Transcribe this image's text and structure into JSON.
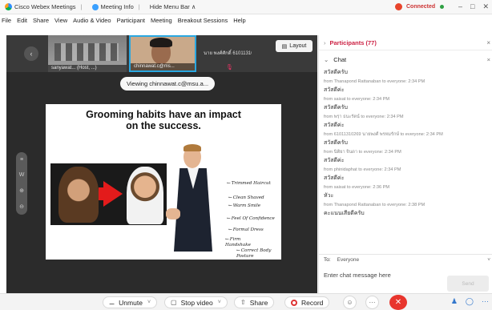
{
  "titlebar": {
    "app_name": "Cisco Webex Meetings",
    "meeting_info": "Meeting Info",
    "hide_menu_bar": "Hide Menu Bar ∧",
    "status": "Connected",
    "minimize": "–",
    "maximize": "□",
    "close": "✕"
  },
  "menu": [
    "File",
    "Edit",
    "Share",
    "View",
    "Audio & Video",
    "Participant",
    "Meeting",
    "Breakout Sessions",
    "Help"
  ],
  "filmstrip": {
    "prev": "‹",
    "thumb1_label": "sanyawat... (Host, ...)",
    "thumb2_label": "chinnawat.c@ms...",
    "thumb3_name": "นาย พงศ์ศักดิ์ 61011310115",
    "thumb3_mic": "🎙",
    "layout_label": "Layout"
  },
  "viewing_label": "Viewing chinnawat.c@msu.a...",
  "side_tools": [
    "≡",
    "W",
    "⊕",
    "⊖"
  ],
  "slide": {
    "title_line1": "Grooming habits have an impact",
    "title_line2": "on the success.",
    "annotations": [
      "Trimmed Haircut",
      "Clean Shaved",
      "Warm Smile",
      "Feel Of Confidence",
      "Formal Dress",
      "Firm Handshake",
      "Correct Body Posture"
    ]
  },
  "panel": {
    "participants_title": "Participants (77)",
    "chat_title": "Chat",
    "close": "×",
    "messages": [
      {
        "text": "สวัสดีครับ",
        "meta": "from Thanapond Rattanaban to everyone:  2:34 PM"
      },
      {
        "text": "สวัสดีค่ะ",
        "meta": "from saisat to everyone:  2:34 PM"
      },
      {
        "text": "สวัสดีครับ",
        "meta": "from พรฺา ธนะรัตน์ to everyone:  2:34 PM"
      },
      {
        "text": "สวัสดีค่ะ",
        "meta": "from 61011310269 นายพงศ์ พรหมรักษ์ to everyone:  2:34 PM"
      },
      {
        "text": "สวัสดีครับ",
        "meta": "from นิติยา จินดา to everyone:  2:34 PM"
      },
      {
        "text": "สวัสดีค่ะ",
        "meta": "from phinidaphat to everyone:  2:34 PM"
      },
      {
        "text": "สวัสดีค่ะ",
        "meta": "from saisat to everyone:  2:36 PM"
      },
      {
        "text": "หัวะ",
        "meta": "from Thanapond Rattanaban to everyone:  2:38 PM"
      },
      {
        "text": "คะแนนเสียดีครับ",
        "meta": ""
      }
    ],
    "to_label": "To:",
    "to_value": "Everyone",
    "to_dropdown": "˅",
    "input_placeholder": "Enter chat message here",
    "send_label": "Send"
  },
  "toolbar": {
    "unmute": "Unmute",
    "stop_video": "Stop video",
    "share": "Share",
    "record": "Record",
    "more": "···",
    "end": "✕",
    "chevron": "˅"
  },
  "colors": {
    "accent": "#2aa7e0",
    "record": "#e8442b",
    "participants_title": "#c24",
    "end_button": "#e8352d"
  }
}
